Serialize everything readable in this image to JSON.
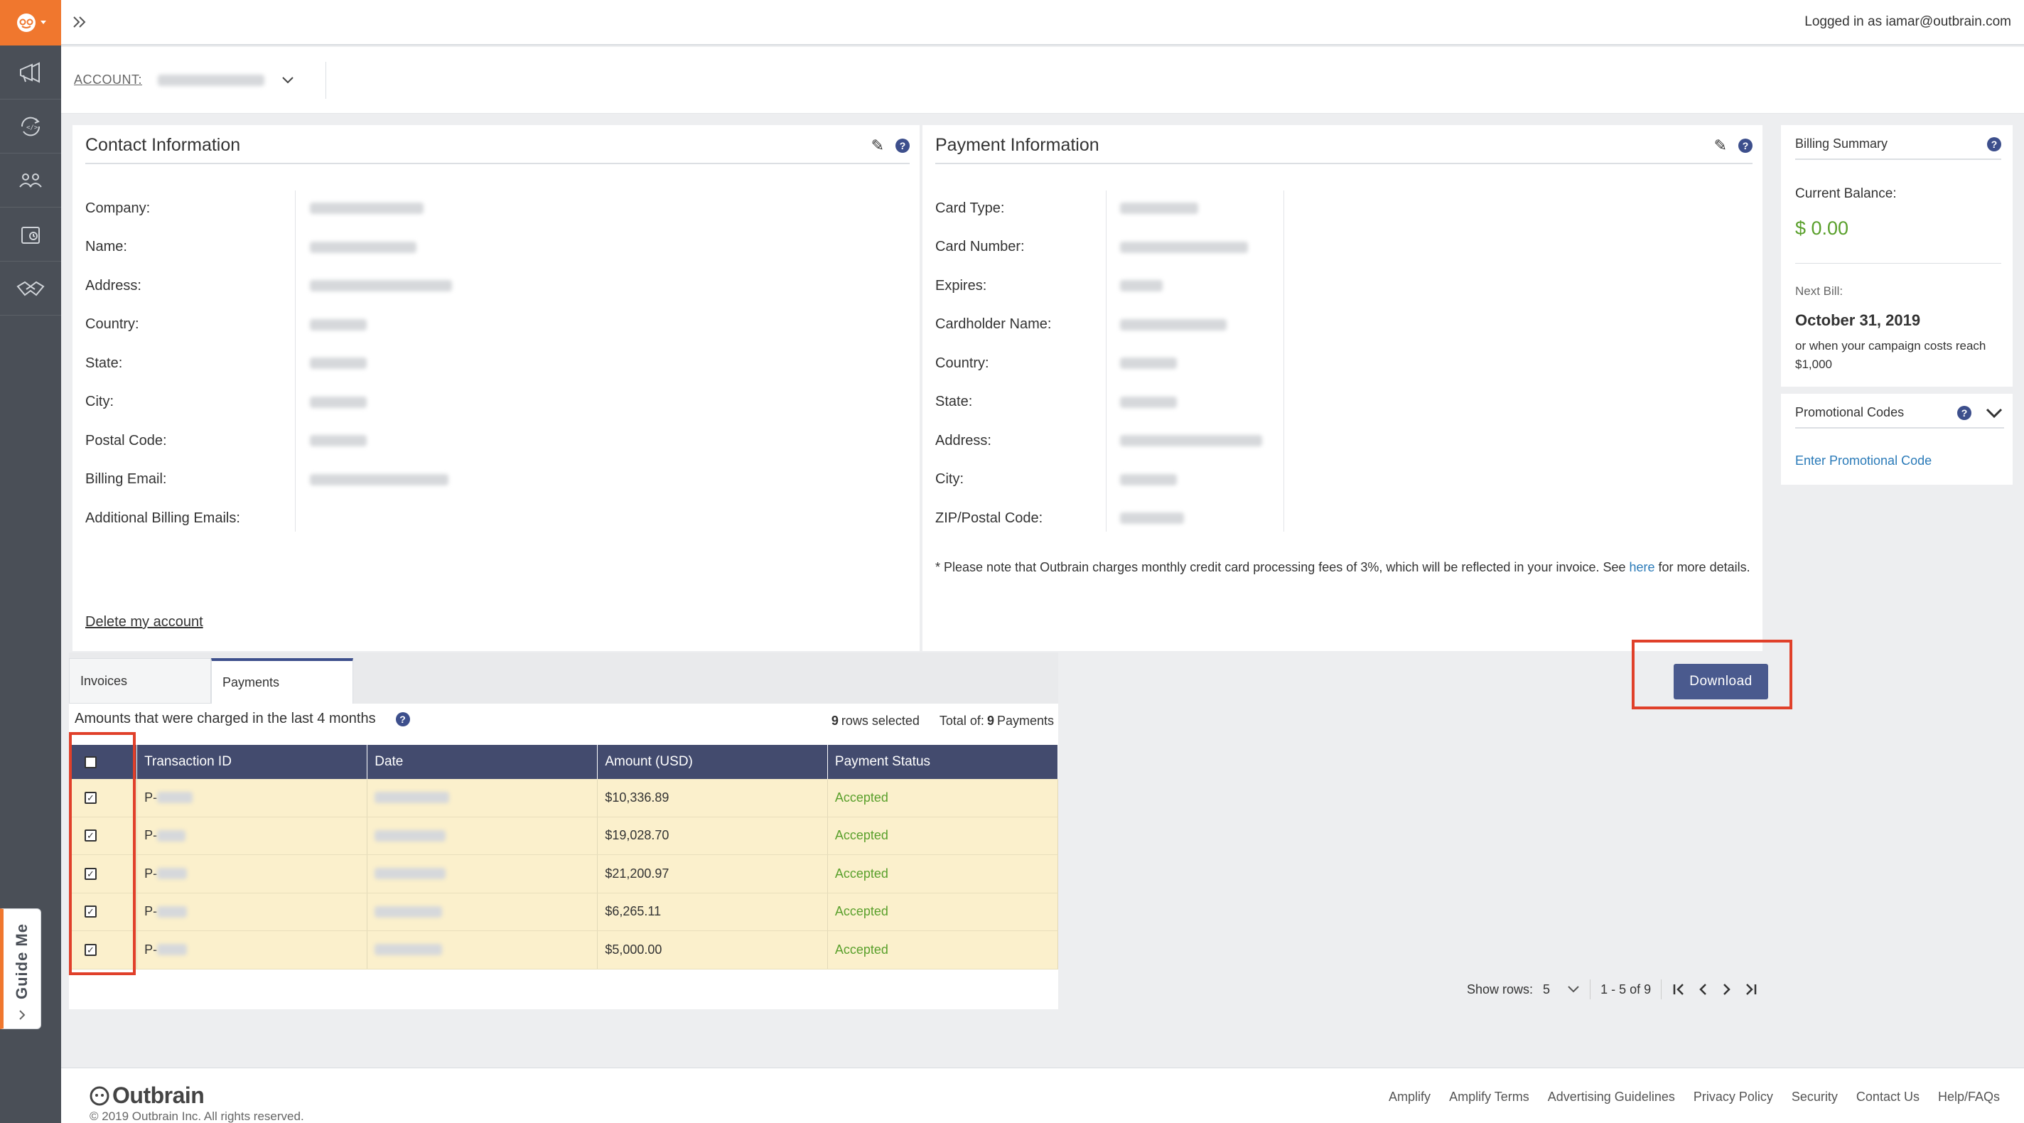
{
  "topbar": {
    "expand_icon": "double-chevron-right-icon",
    "login_text": "Logged in as iamar@outbrain.com"
  },
  "account": {
    "label": "ACCOUNT:"
  },
  "contact": {
    "title": "Contact Information",
    "labels": [
      "Company:",
      "Name:",
      "Address:",
      "Country:",
      "State:",
      "City:",
      "Postal Code:",
      "Billing Email:",
      "Additional Billing Emails:"
    ],
    "delete_link": "Delete my account"
  },
  "payment": {
    "title": "Payment Information",
    "labels": [
      "Card Type:",
      "Card Number:",
      "Expires:",
      "Cardholder Name:",
      "Country:",
      "State:",
      "Address:",
      "City:",
      "ZIP/Postal Code:"
    ],
    "note_prefix": "* Please note that Outbrain charges monthly credit card processing fees of 3%, which will be reflected in your invoice. See ",
    "note_link": "here",
    "note_suffix": " for more details."
  },
  "billing": {
    "title": "Billing Summary",
    "balance_label": "Current Balance:",
    "balance_value": "$ 0.00",
    "next_bill_label": "Next Bill:",
    "next_bill_date": "October 31, 2019",
    "next_bill_note": "or when your campaign costs reach $1,000"
  },
  "promo": {
    "title": "Promotional Codes",
    "link": "Enter Promotional Code"
  },
  "tabs": [
    {
      "label": "Invoices"
    },
    {
      "label": "Payments"
    }
  ],
  "download_label": "Download",
  "table": {
    "caption": "Amounts that were charged in the last 4 months",
    "rows_selected_count": "9",
    "rows_selected_text": "rows selected",
    "total_prefix": "Total of:",
    "total_count": "9",
    "total_suffix": "Payments",
    "headers": [
      "Transaction ID",
      "Date",
      "Amount (USD)",
      "Payment Status"
    ],
    "rows": [
      {
        "id": "P-",
        "amount": "$10,336.89",
        "status": "Accepted"
      },
      {
        "id": "P-",
        "amount": "$19,028.70",
        "status": "Accepted"
      },
      {
        "id": "P-",
        "amount": "$21,200.97",
        "status": "Accepted"
      },
      {
        "id": "P-",
        "amount": "$6,265.11",
        "status": "Accepted"
      },
      {
        "id": "P-",
        "amount": "$5,000.00",
        "status": "Accepted"
      }
    ]
  },
  "pager": {
    "show_rows_label": "Show rows:",
    "show_rows_value": "5",
    "range": "1 - 5 of 9"
  },
  "guide_me": "Guide Me",
  "footer": {
    "brand": "Outbrain",
    "copyright": "© 2019 Outbrain Inc. All rights reserved.",
    "links": [
      "Amplify",
      "Amplify Terms",
      "Advertising Guidelines",
      "Privacy Policy",
      "Security",
      "Contact Us",
      "Help/FAQs"
    ]
  },
  "colors": {
    "accent_orange": "#f0772e",
    "header_navy": "#434b6e",
    "accepted_green": "#5aa02c",
    "highlight_red": "#e0402a"
  }
}
